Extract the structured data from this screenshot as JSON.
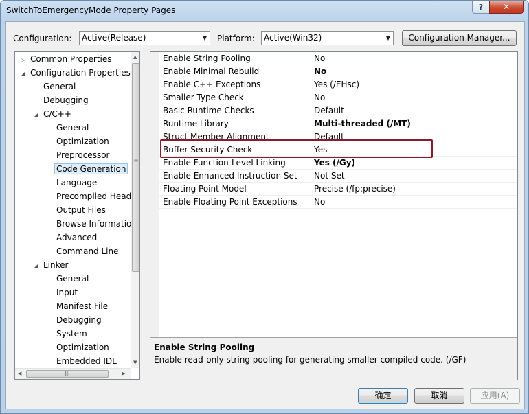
{
  "window": {
    "title": "SwitchToEmergencyMode Property Pages",
    "help_glyph": "?",
    "close_glyph": "✕"
  },
  "toolbar": {
    "configuration_label": "Configuration:",
    "configuration_value": "Active(Release)",
    "platform_label": "Platform:",
    "platform_value": "Active(Win32)",
    "config_manager_label": "Configuration Manager..."
  },
  "tree": {
    "items": [
      {
        "label": "Common Properties",
        "arrow": "▷"
      },
      {
        "label": "Configuration Properties",
        "arrow": "◢"
      },
      {
        "label": "General",
        "arrow": ""
      },
      {
        "label": "Debugging",
        "arrow": ""
      },
      {
        "label": "C/C++",
        "arrow": "◢"
      },
      {
        "label": "General",
        "arrow": ""
      },
      {
        "label": "Optimization",
        "arrow": ""
      },
      {
        "label": "Preprocessor",
        "arrow": ""
      },
      {
        "label": "Code Generation",
        "arrow": "",
        "selected": true
      },
      {
        "label": "Language",
        "arrow": ""
      },
      {
        "label": "Precompiled Head",
        "arrow": ""
      },
      {
        "label": "Output Files",
        "arrow": ""
      },
      {
        "label": "Browse Informatio",
        "arrow": ""
      },
      {
        "label": "Advanced",
        "arrow": ""
      },
      {
        "label": "Command Line",
        "arrow": ""
      },
      {
        "label": "Linker",
        "arrow": "◢"
      },
      {
        "label": "General",
        "arrow": ""
      },
      {
        "label": "Input",
        "arrow": ""
      },
      {
        "label": "Manifest File",
        "arrow": ""
      },
      {
        "label": "Debugging",
        "arrow": ""
      },
      {
        "label": "System",
        "arrow": ""
      },
      {
        "label": "Optimization",
        "arrow": ""
      },
      {
        "label": "Embedded IDL",
        "arrow": ""
      }
    ],
    "hscroll_grip": "III",
    "vscroll_grip": "≡"
  },
  "properties": [
    {
      "name": "Enable String Pooling",
      "value": "No",
      "bold": false
    },
    {
      "name": "Enable Minimal Rebuild",
      "value": "No",
      "bold": true
    },
    {
      "name": "Enable C++ Exceptions",
      "value": "Yes (/EHsc)",
      "bold": false
    },
    {
      "name": "Smaller Type Check",
      "value": "No",
      "bold": false
    },
    {
      "name": "Basic Runtime Checks",
      "value": "Default",
      "bold": false
    },
    {
      "name": "Runtime Library",
      "value": "Multi-threaded (/MT)",
      "bold": true
    },
    {
      "name": "Struct Member Alignment",
      "value": "Default",
      "bold": false
    },
    {
      "name": "Buffer Security Check",
      "value": "Yes",
      "bold": false
    },
    {
      "name": "Enable Function-Level Linking",
      "value": "Yes (/Gy)",
      "bold": true
    },
    {
      "name": "Enable Enhanced Instruction Set",
      "value": "Not Set",
      "bold": false
    },
    {
      "name": "Floating Point Model",
      "value": "Precise (/fp:precise)",
      "bold": false
    },
    {
      "name": "Enable Floating Point Exceptions",
      "value": "No",
      "bold": false
    }
  ],
  "description": {
    "title": "Enable String Pooling",
    "text": "Enable read-only string pooling for generating smaller compiled code.     (/GF)"
  },
  "buttons": {
    "ok": "确定",
    "cancel": "取消",
    "apply": "应用(A)"
  },
  "colors": {
    "highlight_border": "#8b1a2c",
    "selection": "#dfeefb"
  }
}
